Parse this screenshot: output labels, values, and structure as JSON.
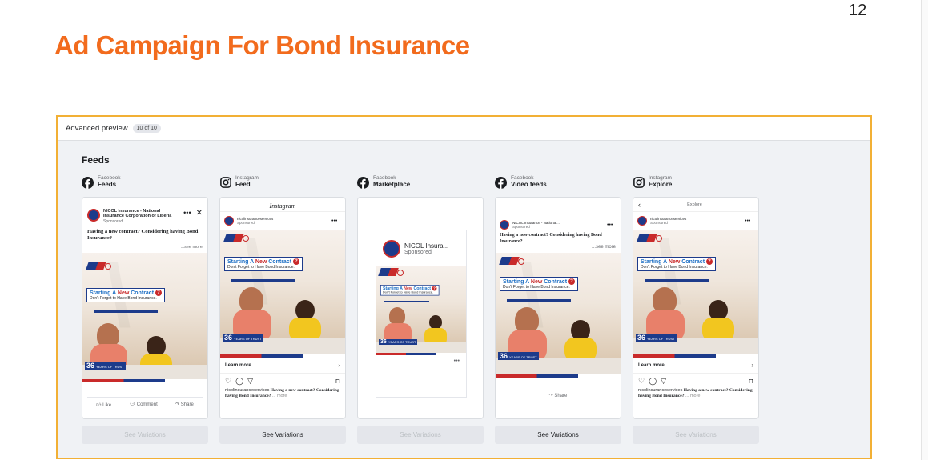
{
  "slide": {
    "page_number": "12",
    "title": "Ad Campaign For Bond Insurance"
  },
  "preview": {
    "title": "Advanced preview",
    "count": "10 of 10",
    "section": "Feeds",
    "frame_color": "#f2b035",
    "columns": [
      {
        "platform": "Facebook",
        "placement": "Feeds",
        "icon": "facebook-icon",
        "variations_label": "See Variations",
        "variations_enabled": false
      },
      {
        "platform": "Instagram",
        "placement": "Feed",
        "icon": "instagram-icon",
        "variations_label": "See Variations",
        "variations_enabled": true
      },
      {
        "platform": "Facebook",
        "placement": "Marketplace",
        "icon": "facebook-icon",
        "variations_label": "See Variations",
        "variations_enabled": false
      },
      {
        "platform": "Facebook",
        "placement": "Video feeds",
        "icon": "facebook-icon",
        "variations_label": "See Variations",
        "variations_enabled": true
      },
      {
        "platform": "Instagram",
        "placement": "Explore",
        "icon": "instagram-icon",
        "variations_label": "See Variations",
        "variations_enabled": false
      }
    ]
  },
  "ad": {
    "fb_account": "NICOL Insurance - National Insurance Corporation of Liberia",
    "fb_account_short": "NICOL Insurance - National...",
    "fb_account_marketplace": "NICOL Insura...",
    "ig_account": "nicolinsuranceservices",
    "sponsored": "Sponsored",
    "body": "Having a new contract? Considering having Bond Insurance?",
    "see_more": "...see more",
    "headline_prefix": "Starting A",
    "headline_new": "New",
    "headline_suffix": "Contract",
    "question": "?",
    "subline": "Don't Forget to Have Bond Insurance.",
    "years_number": "36",
    "years_text": "YEARS OF TRUST",
    "learn_more": "Learn more",
    "ig_caption_user": "nicolinsuranceservices",
    "ig_caption": "Having a new contract? Considering having Bond Insurance?",
    "ig_more": "... more",
    "like": "Like",
    "comment": "Comment",
    "share": "Share",
    "instagram_wordmark": "Instagram",
    "explore_title": "Explore",
    "brand_colors": {
      "orange": "#f26b1d",
      "navy": "#1d3b8b",
      "red": "#c92a2a",
      "yellow": "#f2c61f"
    }
  }
}
